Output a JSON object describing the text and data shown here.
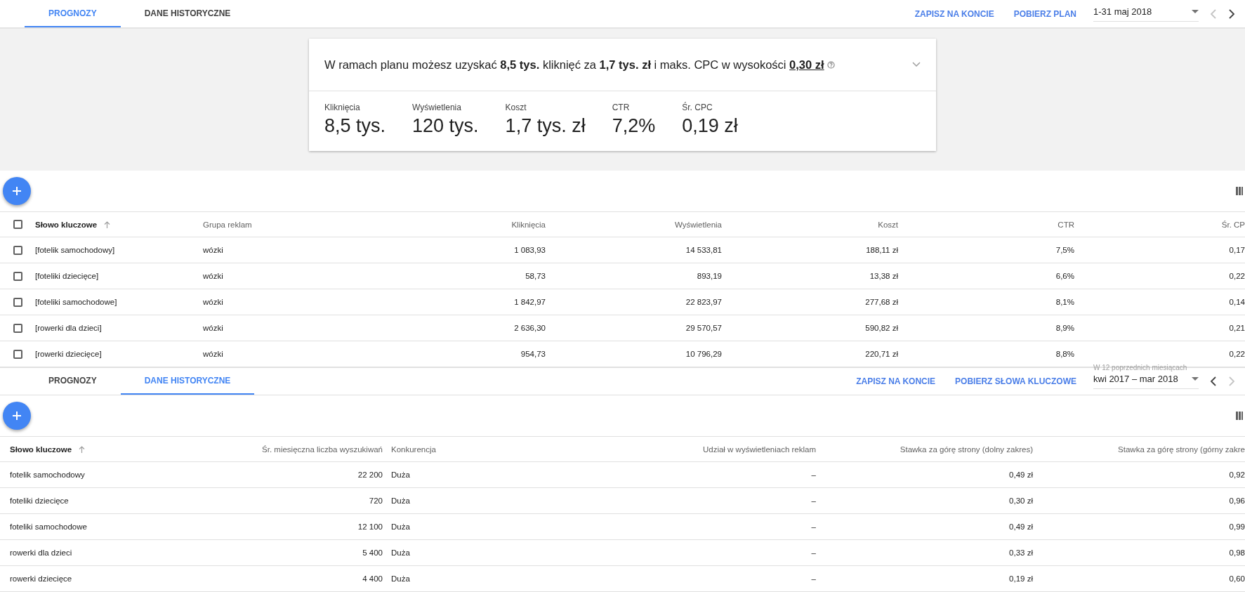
{
  "top_bar": {
    "tabs": [
      {
        "label": "PROGNOZY",
        "selected": true
      },
      {
        "label": "DANE HISTORYCZNE",
        "selected": false
      }
    ],
    "actions": [
      "ZAPISZ NA KONCIE",
      "POBIERZ PLAN"
    ],
    "date": {
      "value": "1-31 maj 2018",
      "prev_disabled": true,
      "next_disabled": false
    }
  },
  "summary": {
    "text": "W ramach planu możesz uzyskać **8,5 tys.** kliknięć za **1,7 tys. zł** i maks. CPC w wysokości",
    "link": "0,30 zł"
  },
  "metrics": [
    {
      "label": "Kliknięcia",
      "value": "8,5 tys."
    },
    {
      "label": "Wyświetlenia",
      "value": "120 tys."
    },
    {
      "label": "Koszt",
      "value": "1,7 tys. zł"
    },
    {
      "label": "CTR",
      "value": "7,2%"
    },
    {
      "label": "Śr. CPC",
      "value": "0,19 zł"
    }
  ],
  "forecast_table": {
    "select_all_checked": false,
    "columns": [
      "Słowo kluczowe",
      "Grupa reklam",
      "Kliknięcia",
      "Wyświetlenia",
      "Koszt",
      "CTR",
      "Śr. CP"
    ],
    "rows": [
      {
        "checked": false,
        "cells": [
          "[fotelik samochodowy]",
          "wózki",
          "1 083,93",
          "14 533,81",
          "188,11 zł",
          "7,5%",
          "0,17"
        ]
      },
      {
        "checked": false,
        "cells": [
          "[foteliki dziecięce]",
          "wózki",
          "58,73",
          "893,19",
          "13,38 zł",
          "6,6%",
          "0,22"
        ]
      },
      {
        "checked": false,
        "cells": [
          "[foteliki samochodowe]",
          "wózki",
          "1 842,97",
          "22 823,97",
          "277,68 zł",
          "8,1%",
          "0,14"
        ]
      },
      {
        "checked": false,
        "cells": [
          "[rowerki dla dzieci]",
          "wózki",
          "2 636,30",
          "29 570,57",
          "590,82 zł",
          "8,9%",
          "0,21"
        ]
      },
      {
        "checked": false,
        "cells": [
          "[rowerki dziecięce]",
          "wózki",
          "954,73",
          "10 796,29",
          "220,71 zł",
          "8,8%",
          "0,22"
        ]
      }
    ]
  },
  "bottom_bar": {
    "tabs": [
      {
        "label": "PROGNOZY",
        "selected": false
      },
      {
        "label": "DANE HISTORYCZNE",
        "selected": true
      }
    ],
    "actions": [
      "ZAPISZ NA KONCIE",
      "POBIERZ SŁOWA KLUCZOWE"
    ],
    "date": {
      "label": "W 12 poprzednich miesiącach",
      "value": "kwi 2017 – mar 2018",
      "prev_disabled": false,
      "next_disabled": true
    }
  },
  "history_table": {
    "columns": [
      "Słowo kluczowe",
      "Śr. miesięczna liczba wyszukiwań",
      "Konkurencja",
      "Udział w wyświetleniach reklam",
      "Stawka za górę strony (dolny zakres)",
      "Stawka za górę strony (górny zakre"
    ],
    "rows": [
      {
        "cells": [
          "fotelik samochodowy",
          "22 200",
          "Duża",
          "–",
          "0,49 zł",
          "0,92"
        ]
      },
      {
        "cells": [
          "foteliki dziecięce",
          "720",
          "Duża",
          "–",
          "0,30 zł",
          "0,96"
        ]
      },
      {
        "cells": [
          "foteliki samochodowe",
          "12 100",
          "Duża",
          "–",
          "0,49 zł",
          "0,99"
        ]
      },
      {
        "cells": [
          "rowerki dla dzieci",
          "5 400",
          "Duża",
          "–",
          "0,33 zł",
          "0,98"
        ]
      },
      {
        "cells": [
          "rowerki dziecięce",
          "4 400",
          "Duża",
          "–",
          "0,19 zł",
          "0,60"
        ]
      }
    ]
  }
}
